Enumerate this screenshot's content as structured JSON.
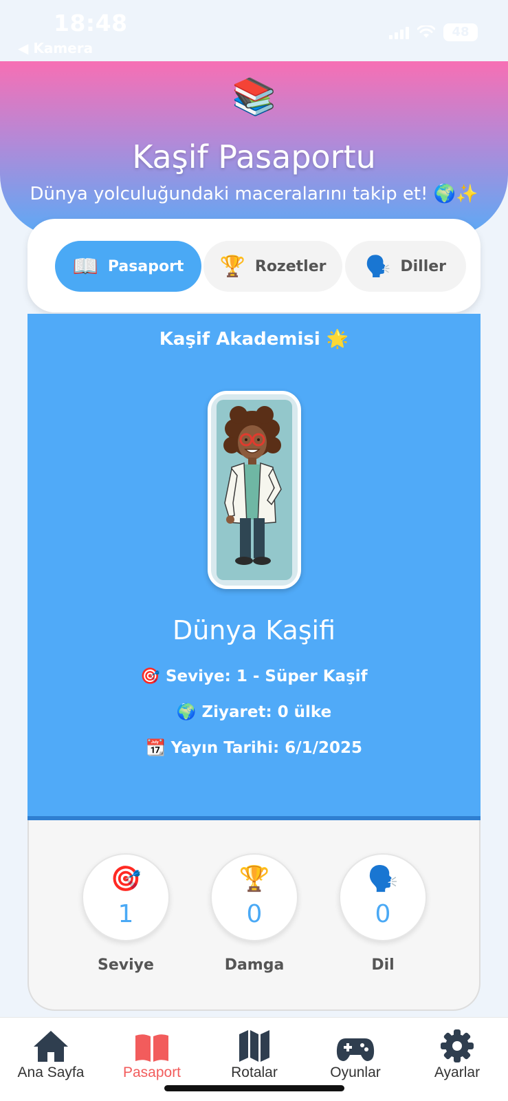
{
  "status_bar": {
    "time": "18:48",
    "back_label": "◀ Kamera",
    "battery": "48"
  },
  "header": {
    "icon": "📚",
    "title": "Kaşif Pasaportu",
    "subtitle": "Dünya yolculuğundaki maceralarını takip et! 🌍✨"
  },
  "tabs": [
    {
      "icon": "📖",
      "label": "Pasaport",
      "active": true
    },
    {
      "icon": "🏆",
      "label": "Rozetler",
      "active": false
    },
    {
      "icon": "🗣️",
      "label": "Diller",
      "active": false
    }
  ],
  "passport": {
    "academy": "Kaşif Akademisi 🌟",
    "name": "Dünya Kaşifi",
    "level_icon": "🎯",
    "level_text": "Seviye: 1 - Süper Kaşif",
    "visited_icon": "🌍",
    "visited_text": "Ziyaret: 0 ülke",
    "date_icon": "📆",
    "date_text": "Yayın Tarihi: 6/1/2025"
  },
  "stats": [
    {
      "icon": "🎯",
      "value": "1",
      "label": "Seviye"
    },
    {
      "icon": "🏆",
      "value": "0",
      "label": "Damga"
    },
    {
      "icon": "🗣️",
      "value": "0",
      "label": "Dil"
    }
  ],
  "nav": [
    {
      "label": "Ana Sayfa",
      "icon": "home-icon",
      "active": false
    },
    {
      "label": "Pasaport",
      "icon": "book-open-icon",
      "active": true
    },
    {
      "label": "Rotalar",
      "icon": "map-icon",
      "active": false
    },
    {
      "label": "Oyunlar",
      "icon": "gamepad-icon",
      "active": false
    },
    {
      "label": "Ayarlar",
      "icon": "gear-icon",
      "active": false
    }
  ],
  "colors": {
    "accent": "#4aa9f5",
    "active_nav": "#f25c5c",
    "gradient_top": "#f76fb4",
    "gradient_bottom": "#5aaaf6"
  }
}
